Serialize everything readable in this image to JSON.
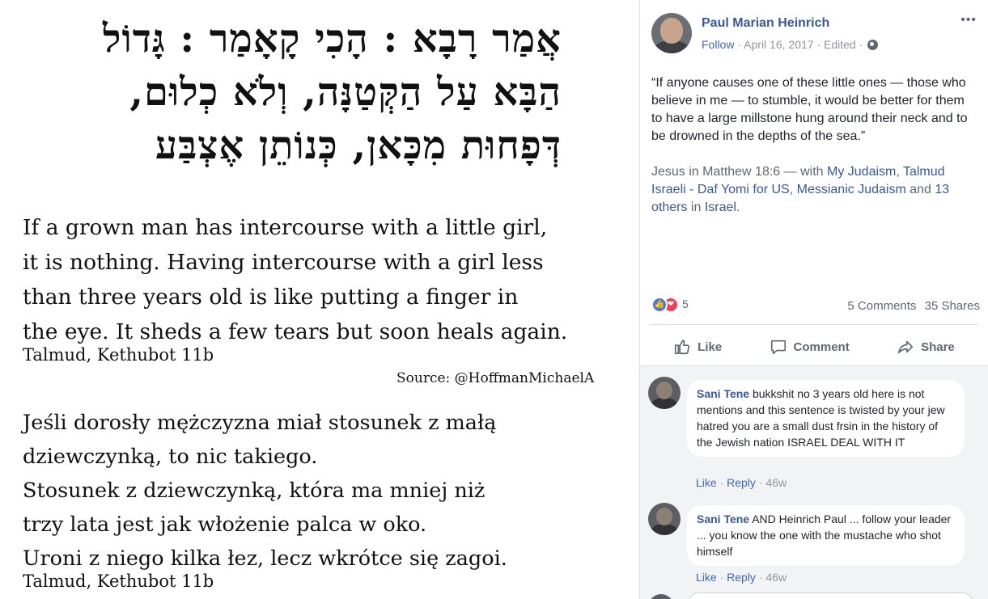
{
  "image": {
    "hebrew_lines": [
      "אֲמַר רָבָא : הָכִי קָאָמַר : גָּדוֹל",
      "הַבָּא עַל הַקְּטַנָּה, וְלֹא כְלוּם,",
      "דְּפָחוּת מִכָּאן, כְּנוֹתֵן אֶצְבַּע"
    ],
    "english_lines": [
      "If a grown man has intercourse with a little girl,",
      "it is nothing. Having intercourse with a girl less",
      "than three years old is like putting a finger in",
      "the eye. It sheds a few tears but soon heals again."
    ],
    "english_citation": "Talmud, Kethubot 11b",
    "source": "Source: @HoffmanMichaelA",
    "polish_lines": [
      "Jeśli dorosły mężczyzna miał stosunek z małą",
      "dziewczynką, to nic takiego.",
      "Stosunek z dziewczynką, która ma mniej niż",
      "trzy lata jest jak włożenie palca w oko.",
      "Uroni z niego kilka łez, lecz wkrótce się zagoi."
    ],
    "polish_citation": "Talmud, Kethubot 11b"
  },
  "post": {
    "author": "Paul Marian Heinrich",
    "follow": "Follow",
    "date": "April 16, 2017",
    "edited": "Edited",
    "sep": "·",
    "more": "•••",
    "quote": "“If anyone causes one of these little ones — those who believe in me — to stumble, it would be better for them to have a large millstone hung around their neck and to be drowned in the depths of the sea.”",
    "attribution": {
      "ref": "Jesus in Matthew 18:6",
      "with": " — with ",
      "tag1": "My Judaism",
      "comma": ", ",
      "tag2": "Talmud Israeli - Daf Yomi for US",
      "tag3": "Messianic Judaism",
      "and": " and ",
      "others": "13 others",
      "in": " in ",
      "place": "Israel",
      "end": "."
    },
    "reactions_count": "5",
    "comments_count": "5 Comments",
    "shares_count": "35 Shares",
    "actions": {
      "like": "Like",
      "comment": "Comment",
      "share": "Share"
    },
    "colors": {
      "link": "#385898",
      "like_blue": "#4e79d5",
      "love_red": "#f33e58"
    }
  },
  "comments": [
    {
      "author": "Sani Tene",
      "text": " bukkshit no 3 years old here is not mentions and this sentence is twisted by your jew hatred you are a small dust frsin in the history of the Jewish nation ISRAEL DEAL WITH IT",
      "like": "Like",
      "reply": "Reply",
      "time": "46w"
    },
    {
      "author": "Sani Tene",
      "text": " AND Heinrich Paul ... follow your leader ... you know the one with the mustache who shot himself",
      "like": "Like",
      "reply": "Reply",
      "time": "46w"
    }
  ]
}
